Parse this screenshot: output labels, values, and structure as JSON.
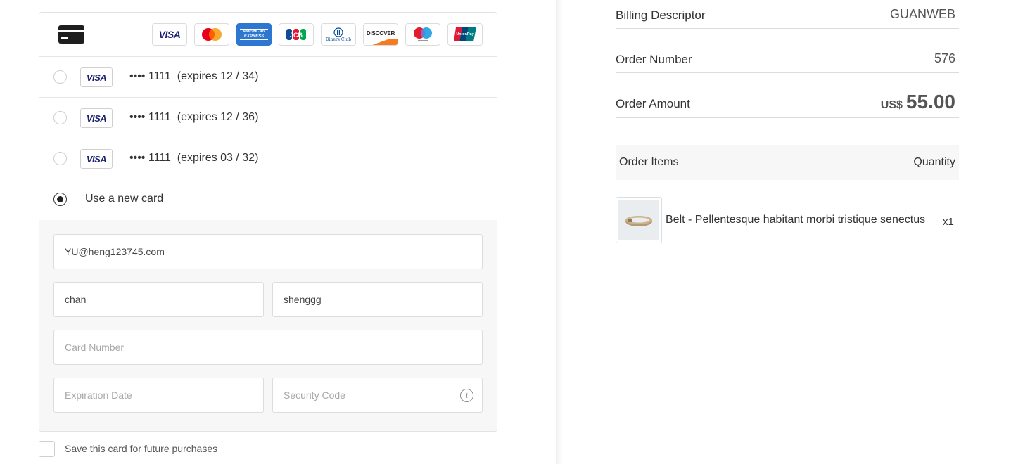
{
  "payment": {
    "brands": [
      {
        "name": "Visa",
        "label": "VISA"
      },
      {
        "name": "Mastercard"
      },
      {
        "name": "American Express",
        "label": "AMERICAN EXPRESS"
      },
      {
        "name": "JCB",
        "label": "JCB"
      },
      {
        "name": "Diners Club",
        "label": "Diners Club"
      },
      {
        "name": "Discover",
        "label": "DISCOVER"
      },
      {
        "name": "Maestro"
      },
      {
        "name": "UnionPay",
        "label": "UnionPay"
      }
    ],
    "saved_cards": [
      {
        "brand": "VISA",
        "masked": "•••• 1111",
        "expiry_text": "(expires 12 / 34)"
      },
      {
        "brand": "VISA",
        "masked": "•••• 1111",
        "expiry_text": "(expires 12 / 36)"
      },
      {
        "brand": "VISA",
        "masked": "•••• 1111",
        "expiry_text": "(expires 03 / 32)"
      }
    ],
    "new_card_label": "Use a new card",
    "new_card_selected": true,
    "form": {
      "email": {
        "value": "YU@heng123745.com"
      },
      "first_name": {
        "value": "chan"
      },
      "last_name": {
        "value": "shenggg"
      },
      "card_number": {
        "value": "",
        "placeholder": "Card Number"
      },
      "expiration": {
        "value": "",
        "placeholder": "Expiration Date"
      },
      "security_code": {
        "value": "",
        "placeholder": "Security Code"
      }
    },
    "save_card_label": "Save this card for future purchases"
  },
  "summary": {
    "billing_descriptor_label": "Billing Descriptor",
    "billing_descriptor_value": "GUANWEB",
    "order_number_label": "Order Number",
    "order_number_value": "576",
    "order_amount_label": "Order Amount",
    "currency": "US$",
    "amount": "55.00",
    "items_header": "Order Items",
    "quantity_header": "Quantity",
    "items": [
      {
        "name": "Belt - Pellentesque habitant morbi tristique senectus",
        "quantity": "x1"
      }
    ]
  },
  "colors": {
    "amex_blue": "#2e77d0",
    "visa_navy": "#1a1f71",
    "mastercard_red": "#eb001b",
    "mastercard_orange": "#f79e1b",
    "discover_orange": "#f47b20"
  }
}
